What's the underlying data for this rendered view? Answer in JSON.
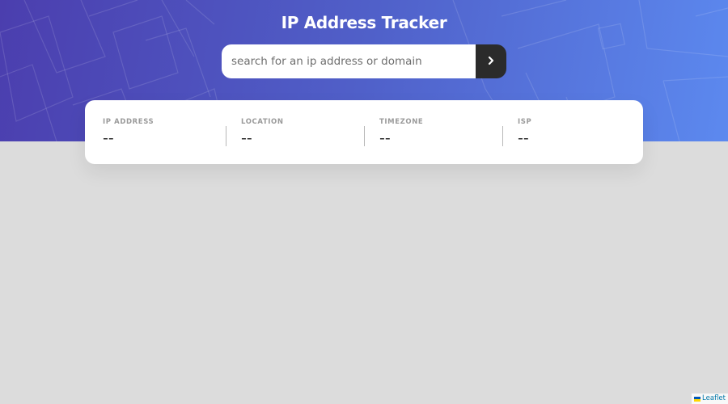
{
  "header": {
    "title": "IP Address Tracker",
    "background_gradient": [
      "#4b3eae",
      "#5060c9",
      "#5c89ef"
    ]
  },
  "search": {
    "placeholder": "search for an ip address or domain",
    "value": "",
    "submit_icon": "chevron-right-icon"
  },
  "info": {
    "ip_address": {
      "label": "IP ADDRESS",
      "value": "--"
    },
    "location": {
      "label": "LOCATION",
      "value": "--"
    },
    "timezone": {
      "label": "TIMEZONE",
      "value": "--"
    },
    "isp": {
      "label": "ISP",
      "value": "--"
    }
  },
  "map": {
    "background_color": "#dcdcdc",
    "attribution": {
      "link_text": "Leaflet",
      "icon": "ukraine-flag-icon",
      "flag_colors": [
        "#0057b7",
        "#ffd700"
      ]
    }
  },
  "colors": {
    "dark": "#2b2b2b",
    "label_gray": "#9a9a9a",
    "link_blue": "#0078a8"
  }
}
